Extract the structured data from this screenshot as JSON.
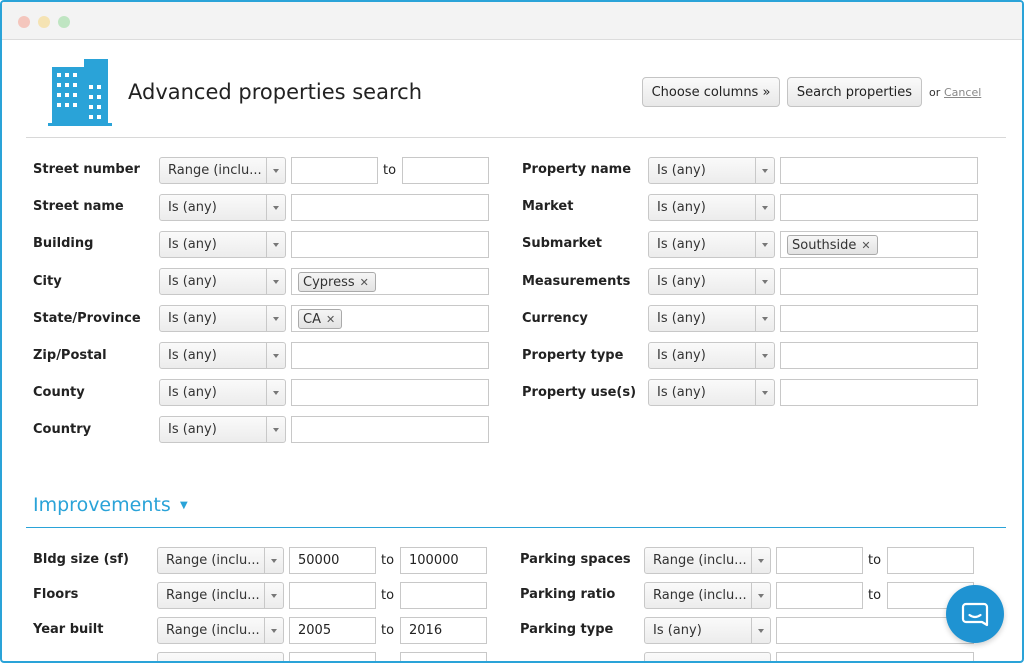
{
  "page": {
    "title": "Advanced properties search",
    "choose_columns": "Choose columns »",
    "search_button": "Search properties",
    "or": "or",
    "cancel": "Cancel"
  },
  "range_sel": "Range (inclu...",
  "is_any": "Is (any)",
  "to": "to",
  "left_fields": {
    "street_number": "Street number",
    "street_name": "Street name",
    "building": "Building",
    "city": "City",
    "city_tag": "Cypress",
    "state": "State/Province",
    "state_tag": "CA",
    "zip": "Zip/Postal",
    "county": "County",
    "country": "Country"
  },
  "right_fields": {
    "property_name": "Property name",
    "market": "Market",
    "submarket": "Submarket",
    "submarket_tag": "Southside",
    "measurements": "Measurements",
    "currency": "Currency",
    "property_type": "Property type",
    "property_uses": "Property use(s)"
  },
  "improvements": {
    "title": "Improvements",
    "bldg_size": "Bldg size (sf)",
    "bldg_size_from": "50000",
    "bldg_size_to": "100000",
    "floors": "Floors",
    "year_built": "Year built",
    "year_built_from": "2005",
    "year_built_to": "2016",
    "parking_spaces": "Parking spaces",
    "parking_ratio": "Parking ratio",
    "parking_type": "Parking type"
  },
  "colors": {
    "accent": "#2aa3d8",
    "chat": "#1f93d2"
  },
  "icons": {
    "logo": "building-icon",
    "chat": "chat-icon"
  }
}
